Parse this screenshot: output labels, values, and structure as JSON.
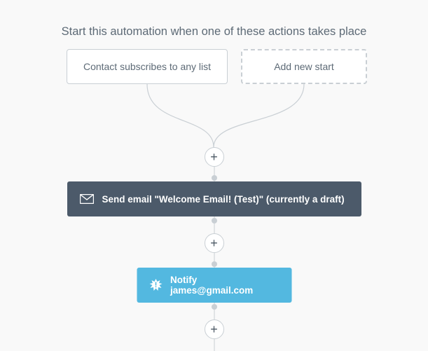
{
  "heading": "Start this automation when one of these actions takes place",
  "start_triggers": {
    "subscribe_label": "Contact subscribes to any list",
    "add_new_label": "Add new start"
  },
  "actions": {
    "send_email_label": "Send email \"Welcome Email! (Test)\" (currently a draft)",
    "notify_label": "Notify james@gmail.com"
  },
  "plus_glyph": "+",
  "colors": {
    "card_email_bg": "#4c5a6a",
    "card_notify_bg": "#53b8e0",
    "line": "#c9cfd4",
    "bg": "#f9f9f9"
  }
}
